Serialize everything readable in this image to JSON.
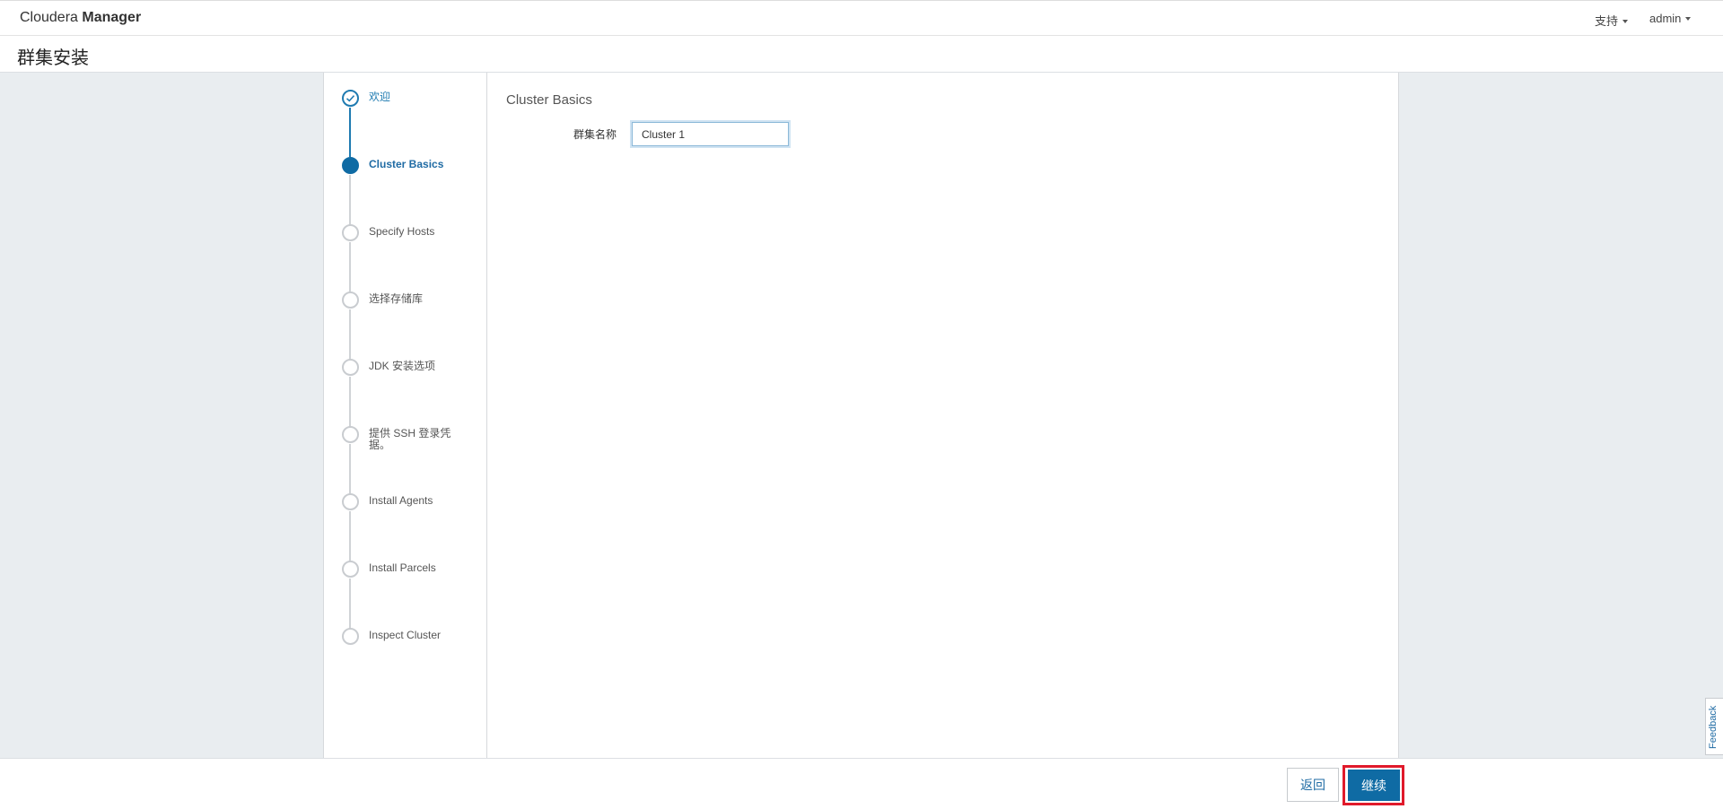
{
  "header": {
    "brand_light": "Cloudera ",
    "brand_bold": "Manager",
    "nav": [
      {
        "label": "支持"
      },
      {
        "label": "admin"
      }
    ]
  },
  "page": {
    "title": "群集安装"
  },
  "steps": [
    {
      "label": "欢迎",
      "state": "done"
    },
    {
      "label": "Cluster Basics",
      "state": "current"
    },
    {
      "label": "Specify Hosts",
      "state": "pending"
    },
    {
      "label": "选择存储库",
      "state": "pending"
    },
    {
      "label": "JDK 安装选项",
      "state": "pending"
    },
    {
      "label": "提供 SSH 登录凭据。",
      "state": "pending"
    },
    {
      "label": "Install Agents",
      "state": "pending"
    },
    {
      "label": "Install Parcels",
      "state": "pending"
    },
    {
      "label": "Inspect Cluster",
      "state": "pending"
    }
  ],
  "content": {
    "section_title": "Cluster Basics",
    "cluster_name": {
      "label": "群集名称",
      "value": "Cluster 1"
    }
  },
  "footer": {
    "back_label": "返回",
    "continue_label": "继续"
  },
  "feedback": {
    "label": "Feedback"
  },
  "colors": {
    "accent": "#0f6ba4",
    "highlight": "#e01a2b",
    "background": "#e9edf0"
  }
}
